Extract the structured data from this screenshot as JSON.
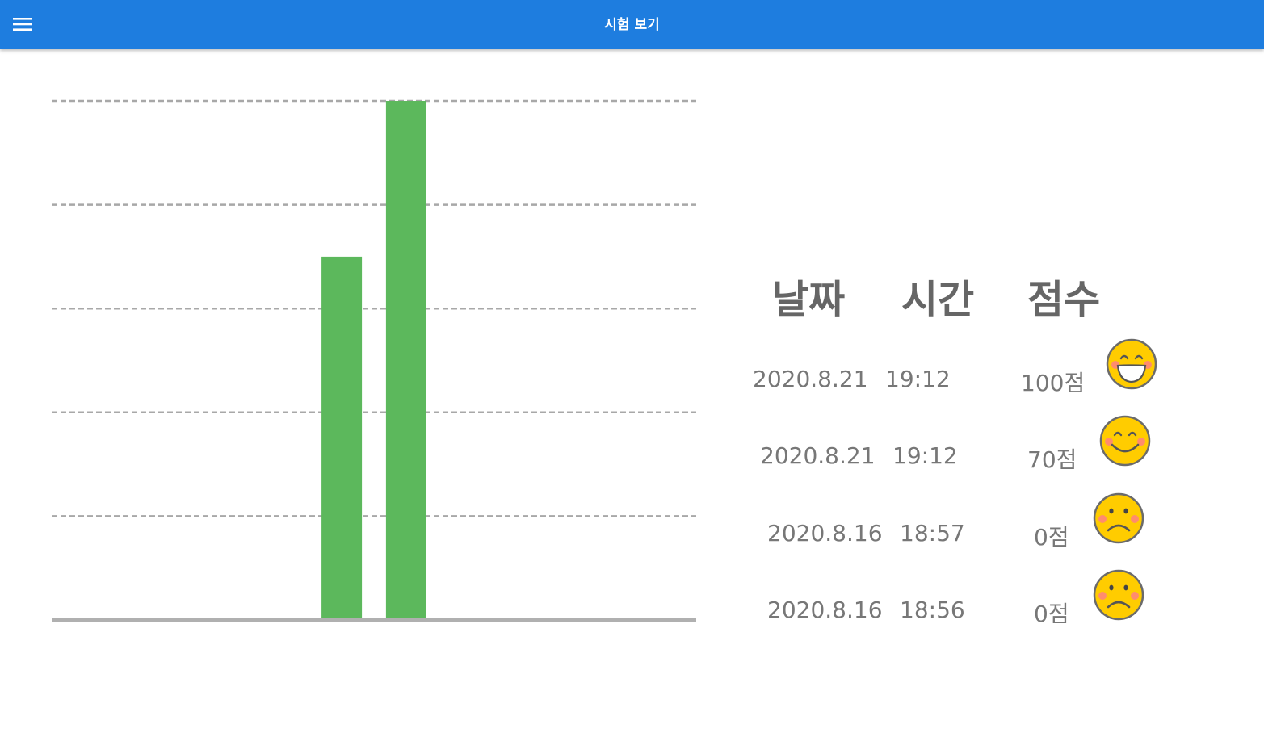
{
  "app": {
    "title": "시험 보기",
    "menu_icon": "hamburger-menu-icon",
    "bar_color": "#1e7ddf"
  },
  "chart_data": {
    "type": "bar",
    "categories": [
      "",
      "",
      "",
      "",
      "",
      "",
      "",
      "",
      "",
      ""
    ],
    "values": [
      0,
      0,
      0,
      0,
      70,
      100,
      0,
      0,
      0,
      0
    ],
    "ylim": [
      0,
      100
    ],
    "grid": true,
    "color": "#5cb85c"
  },
  "table": {
    "headers": [
      "날짜",
      "시간",
      "점수"
    ],
    "rows": [
      {
        "date": "2020.8.21",
        "time": "19:12",
        "score": "100점",
        "icon": "grinning-face-icon",
        "mood": "very-happy"
      },
      {
        "date": "2020.8.21",
        "time": "19:12",
        "score": "70점",
        "icon": "smiling-face-icon",
        "mood": "happy"
      },
      {
        "date": "2020.8.16",
        "time": "18:57",
        "score": "0점",
        "icon": "frowning-face-icon",
        "mood": "sad"
      },
      {
        "date": "2020.8.16",
        "time": "18:56",
        "score": "0점",
        "icon": "frowning-face-icon",
        "mood": "sad"
      }
    ]
  }
}
